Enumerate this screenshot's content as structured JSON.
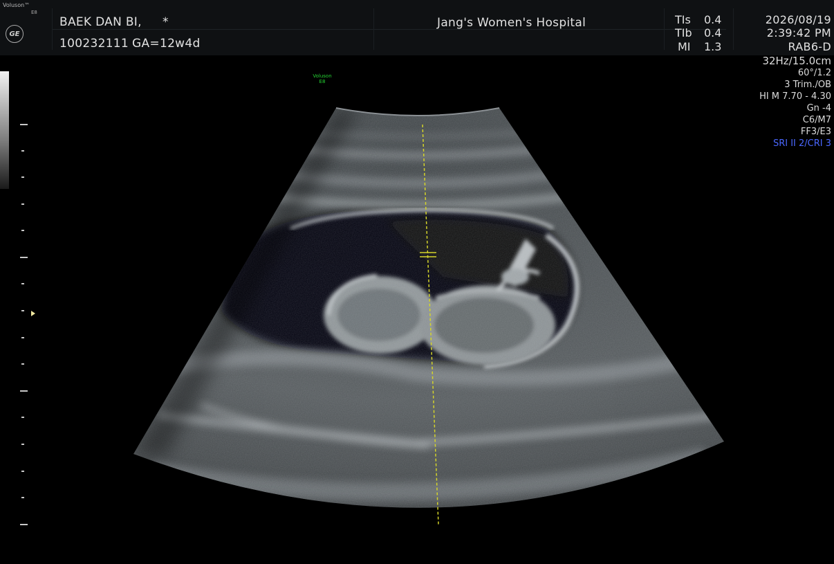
{
  "header": {
    "brand": "Voluson™",
    "brand_model": "E8",
    "logo_text": "GE",
    "patient_name": "BAEK DAN BI,",
    "patient_flag": "*",
    "patient_id": "100232111",
    "gestational_age": "GA=12w4d",
    "hospital": "Jang's Women's Hospital",
    "tis_label": "TIs",
    "tis_value": "0.4",
    "tib_label": "TIb",
    "tib_value": "0.4",
    "mi_label": "MI",
    "mi_value": "1.3",
    "date": "2026/08/19",
    "time": "2:39:42 PM",
    "probe": "RAB6-D"
  },
  "params": {
    "frame_depth": "32Hz/15.0cm",
    "angle": "60°/1.2",
    "preset": "3 Trim./OB",
    "harmonic": "HI M  7.70 - 4.30",
    "gain": "Gn  -4",
    "map": "C6/M7",
    "filter": "FF3/E3",
    "sri": "SRI II 2/CRI 3"
  },
  "image_label": {
    "line1": "Voluson",
    "line2": "E8"
  },
  "colors": {
    "caliper": "#d4d42a",
    "sri_text": "#4a67ff",
    "mini_label": "#25d433",
    "header_bg": "#0f1113"
  },
  "icons": {
    "logo": "ge-logo",
    "focus": "focus-marker-icon"
  }
}
